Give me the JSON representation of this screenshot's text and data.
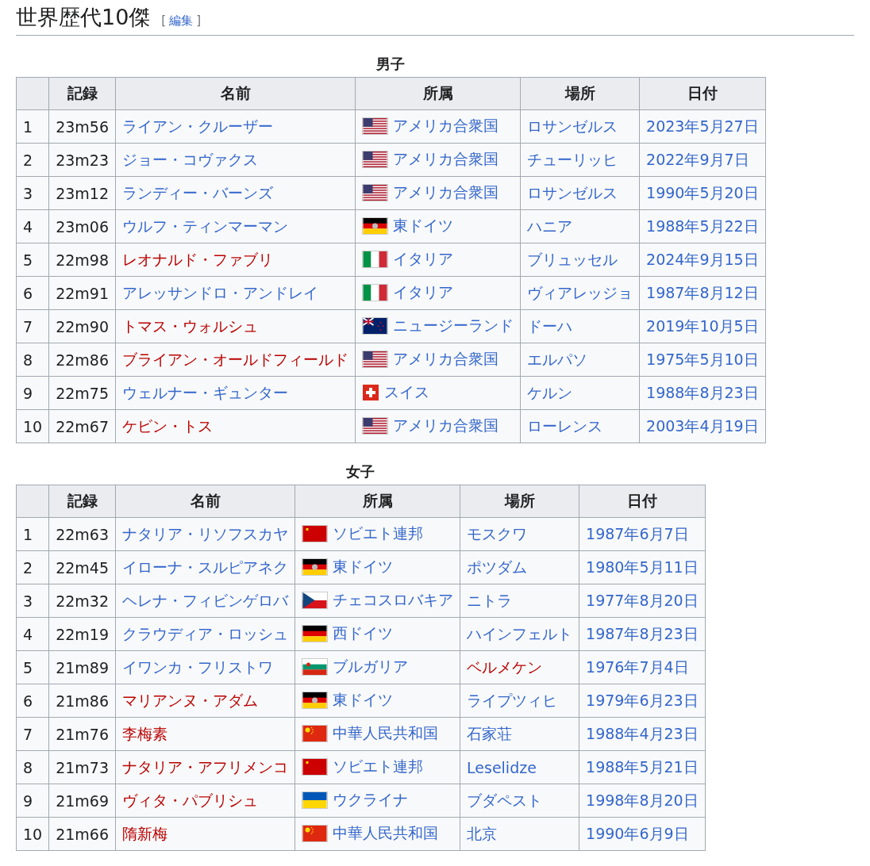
{
  "heading": {
    "title": "世界歴代10傑",
    "edit_open": "[",
    "edit_link": "編集",
    "edit_close": "]"
  },
  "tables": [
    {
      "caption": "男子",
      "columns": [
        "",
        "記録",
        "名前",
        "所属",
        "場所",
        "日付"
      ],
      "rows": [
        {
          "rank": "1",
          "record": "23m56",
          "name": {
            "text": "ライアン・クルーザー",
            "red_link": false
          },
          "country": {
            "text": "アメリカ合衆国",
            "kind": "us",
            "red_link": false
          },
          "place": {
            "text": "ロサンゼルス",
            "red_link": false
          },
          "date": {
            "text": "2023年5月27日",
            "red_link": false
          }
        },
        {
          "rank": "2",
          "record": "23m23",
          "name": {
            "text": "ジョー・コヴァクス",
            "red_link": false
          },
          "country": {
            "text": "アメリカ合衆国",
            "kind": "us",
            "red_link": false
          },
          "place": {
            "text": "チューリッヒ",
            "red_link": false
          },
          "date": {
            "text": "2022年9月7日",
            "red_link": false
          }
        },
        {
          "rank": "3",
          "record": "23m12",
          "name": {
            "text": "ランディー・バーンズ",
            "red_link": false
          },
          "country": {
            "text": "アメリカ合衆国",
            "kind": "us",
            "red_link": false
          },
          "place": {
            "text": "ロサンゼルス",
            "red_link": false
          },
          "date": {
            "text": "1990年5月20日",
            "red_link": false
          }
        },
        {
          "rank": "4",
          "record": "23m06",
          "name": {
            "text": "ウルフ・ティンマーマン",
            "red_link": false
          },
          "country": {
            "text": "東ドイツ",
            "kind": "gdr",
            "red_link": false
          },
          "place": {
            "text": "ハニア",
            "red_link": false
          },
          "date": {
            "text": "1988年5月22日",
            "red_link": false
          }
        },
        {
          "rank": "5",
          "record": "22m98",
          "name": {
            "text": "レオナルド・ファブリ",
            "red_link": true
          },
          "country": {
            "text": "イタリア",
            "kind": "it",
            "red_link": false
          },
          "place": {
            "text": "ブリュッセル",
            "red_link": false
          },
          "date": {
            "text": "2024年9月15日",
            "red_link": false
          }
        },
        {
          "rank": "6",
          "record": "22m91",
          "name": {
            "text": "アレッサンドロ・アンドレイ",
            "red_link": false
          },
          "country": {
            "text": "イタリア",
            "kind": "it",
            "red_link": false
          },
          "place": {
            "text": "ヴィアレッジョ",
            "red_link": false
          },
          "date": {
            "text": "1987年8月12日",
            "red_link": false
          }
        },
        {
          "rank": "7",
          "record": "22m90",
          "name": {
            "text": "トマス・ウォルシュ",
            "red_link": true
          },
          "country": {
            "text": "ニュージーランド",
            "kind": "nz",
            "red_link": false
          },
          "place": {
            "text": "ドーハ",
            "red_link": false
          },
          "date": {
            "text": "2019年10月5日",
            "red_link": false
          }
        },
        {
          "rank": "8",
          "record": "22m86",
          "name": {
            "text": "ブライアン・オールドフィールド",
            "red_link": true
          },
          "country": {
            "text": "アメリカ合衆国",
            "kind": "us",
            "red_link": false
          },
          "place": {
            "text": "エルパソ",
            "red_link": false
          },
          "date": {
            "text": "1975年5月10日",
            "red_link": false
          }
        },
        {
          "rank": "9",
          "record": "22m75",
          "name": {
            "text": "ウェルナー・ギュンター",
            "red_link": false
          },
          "country": {
            "text": "スイス",
            "kind": "ch",
            "red_link": false
          },
          "place": {
            "text": "ケルン",
            "red_link": false
          },
          "date": {
            "text": "1988年8月23日",
            "red_link": false
          }
        },
        {
          "rank": "10",
          "record": "22m67",
          "name": {
            "text": "ケビン・トス",
            "red_link": true
          },
          "country": {
            "text": "アメリカ合衆国",
            "kind": "us",
            "red_link": false
          },
          "place": {
            "text": "ローレンス",
            "red_link": false
          },
          "date": {
            "text": "2003年4月19日",
            "red_link": false
          }
        }
      ]
    },
    {
      "caption": "女子",
      "columns": [
        "",
        "記録",
        "名前",
        "所属",
        "場所",
        "日付"
      ],
      "rows": [
        {
          "rank": "1",
          "record": "22m63",
          "name": {
            "text": "ナタリア・リソフスカヤ",
            "red_link": false
          },
          "country": {
            "text": "ソビエト連邦",
            "kind": "su",
            "red_link": false
          },
          "place": {
            "text": "モスクワ",
            "red_link": false
          },
          "date": {
            "text": "1987年6月7日",
            "red_link": false
          }
        },
        {
          "rank": "2",
          "record": "22m45",
          "name": {
            "text": "イローナ・スルピアネク",
            "red_link": false
          },
          "country": {
            "text": "東ドイツ",
            "kind": "gdr",
            "red_link": false
          },
          "place": {
            "text": "ポツダム",
            "red_link": false
          },
          "date": {
            "text": "1980年5月11日",
            "red_link": false
          }
        },
        {
          "rank": "3",
          "record": "22m32",
          "name": {
            "text": "ヘレナ・フィビンゲロバ",
            "red_link": false
          },
          "country": {
            "text": "チェコスロバキア",
            "kind": "cz",
            "red_link": false
          },
          "place": {
            "text": "ニトラ",
            "red_link": false
          },
          "date": {
            "text": "1977年8月20日",
            "red_link": false
          }
        },
        {
          "rank": "4",
          "record": "22m19",
          "name": {
            "text": "クラウディア・ロッシュ",
            "red_link": false
          },
          "country": {
            "text": "西ドイツ",
            "kind": "de",
            "red_link": false
          },
          "place": {
            "text": "ハインフェルト",
            "red_link": false
          },
          "date": {
            "text": "1987年8月23日",
            "red_link": false
          }
        },
        {
          "rank": "5",
          "record": "21m89",
          "name": {
            "text": "イワンカ・フリストワ",
            "red_link": false
          },
          "country": {
            "text": "ブルガリア",
            "kind": "bg",
            "red_link": false
          },
          "place": {
            "text": "ベルメケン",
            "red_link": true
          },
          "date": {
            "text": "1976年7月4日",
            "red_link": false
          }
        },
        {
          "rank": "6",
          "record": "21m86",
          "name": {
            "text": "マリアンヌ・アダム",
            "red_link": true
          },
          "country": {
            "text": "東ドイツ",
            "kind": "gdr",
            "red_link": false
          },
          "place": {
            "text": "ライプツィヒ",
            "red_link": false
          },
          "date": {
            "text": "1979年6月23日",
            "red_link": false
          }
        },
        {
          "rank": "7",
          "record": "21m76",
          "name": {
            "text": "李梅素",
            "red_link": true
          },
          "country": {
            "text": "中華人民共和国",
            "kind": "cn",
            "red_link": false
          },
          "place": {
            "text": "石家荘",
            "red_link": false
          },
          "date": {
            "text": "1988年4月23日",
            "red_link": false
          }
        },
        {
          "rank": "8",
          "record": "21m73",
          "name": {
            "text": "ナタリア・アフリメンコ",
            "red_link": true
          },
          "country": {
            "text": "ソビエト連邦",
            "kind": "su",
            "red_link": false
          },
          "place": {
            "text": "Leselidze",
            "red_link": false
          },
          "date": {
            "text": "1988年5月21日",
            "red_link": false
          }
        },
        {
          "rank": "9",
          "record": "21m69",
          "name": {
            "text": "ヴィタ・パブリシュ",
            "red_link": true
          },
          "country": {
            "text": "ウクライナ",
            "kind": "ua",
            "red_link": false
          },
          "place": {
            "text": "ブダペスト",
            "red_link": false
          },
          "date": {
            "text": "1998年8月20日",
            "red_link": false
          }
        },
        {
          "rank": "10",
          "record": "21m66",
          "name": {
            "text": "隋新梅",
            "red_link": true
          },
          "country": {
            "text": "中華人民共和国",
            "kind": "cn",
            "red_link": false
          },
          "place": {
            "text": "北京",
            "red_link": false
          },
          "date": {
            "text": "1990年6月9日",
            "red_link": false
          }
        }
      ]
    }
  ]
}
